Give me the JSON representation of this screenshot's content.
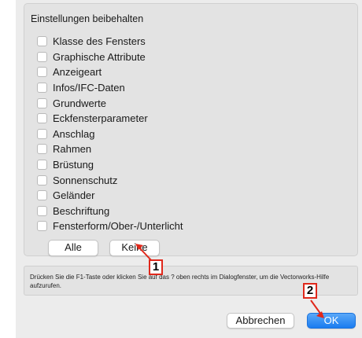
{
  "group": {
    "title": "Einstellungen beibehalten",
    "options": [
      {
        "label": "Klasse des Fensters",
        "checked": false
      },
      {
        "label": "Graphische Attribute",
        "checked": false
      },
      {
        "label": "Anzeigeart",
        "checked": false
      },
      {
        "label": "Infos/IFC-Daten",
        "checked": false
      },
      {
        "label": "Grundwerte",
        "checked": false
      },
      {
        "label": "Eckfensterparameter",
        "checked": false
      },
      {
        "label": "Anschlag",
        "checked": false
      },
      {
        "label": "Rahmen",
        "checked": false
      },
      {
        "label": "Brüstung",
        "checked": false
      },
      {
        "label": "Sonnenschutz",
        "checked": false
      },
      {
        "label": "Geländer",
        "checked": false
      },
      {
        "label": "Beschriftung",
        "checked": false
      },
      {
        "label": "Fensterform/Ober-/Unterlicht",
        "checked": false
      }
    ],
    "all_label": "Alle",
    "none_label": "Keine"
  },
  "help": {
    "text": "Drücken Sie die F1-Taste oder klicken Sie auf das ? oben rechts im Dialogfenster, um die Vectorworks-Hilfe aufzurufen."
  },
  "footer": {
    "cancel_label": "Abbrechen",
    "ok_label": "OK"
  },
  "annotations": {
    "callout_1": "1",
    "callout_2": "2",
    "color": "#e0281b"
  },
  "colors": {
    "accent": "#1a7cf0"
  }
}
